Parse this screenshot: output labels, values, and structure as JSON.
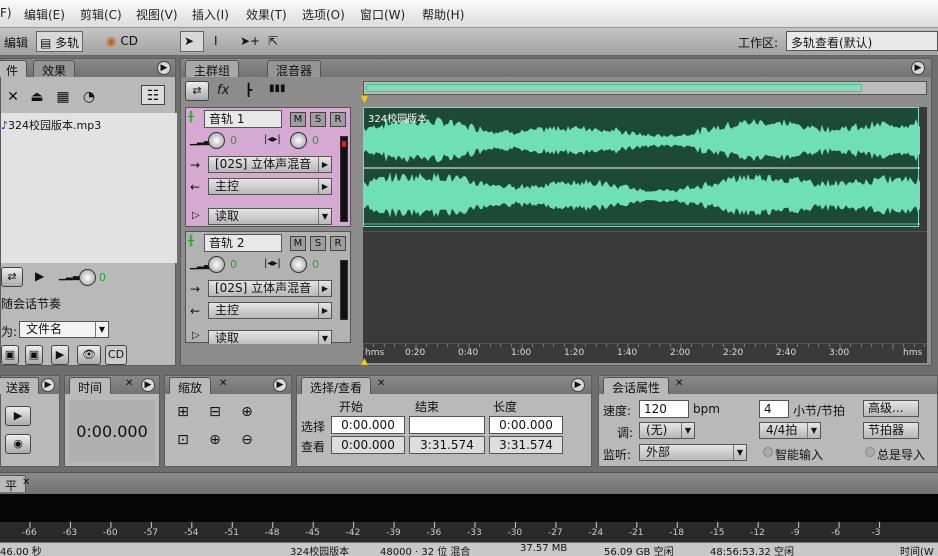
{
  "menu": [
    "F)",
    "编辑(E)",
    "剪辑(C)",
    "视图(V)",
    "插入(I)",
    "效果(T)",
    "选项(O)",
    "窗口(W)",
    "帮助(H)"
  ],
  "toolbar": {
    "edit": "编辑",
    "multitrack": "多轨",
    "cd": "CD",
    "workspace_label": "工作区:",
    "workspace_value": "多轨查看(默认)"
  },
  "files_panel": {
    "tab_files": "件",
    "tab_effects": "效果",
    "file": "324校园版本.mp3",
    "session_tempo": "随会话节奏",
    "sort_label": "为:",
    "sort_value": "文件名"
  },
  "main_tabs": {
    "main": "主群组",
    "mixer": "混音器"
  },
  "tracks": [
    {
      "name": "音轨 1",
      "vol": "0",
      "pan": "0",
      "input": "[02S] 立体声混音",
      "output": "主控",
      "mode": "读取"
    },
    {
      "name": "音轨 2",
      "vol": "0",
      "pan": "0",
      "input": "[02S] 立体声混音",
      "output": "主控",
      "mode": "读取"
    }
  ],
  "clip_name": "324校园版本",
  "timeline_ticks": [
    "hms",
    "0:20",
    "0:40",
    "1:00",
    "1:20",
    "1:40",
    "2:00",
    "2:20",
    "2:40",
    "3:00",
    "hms"
  ],
  "transport_panel": {
    "title": "送器"
  },
  "time_panel": {
    "title": "时间",
    "value": "0:00.000"
  },
  "zoom_panel": {
    "title": "缩放"
  },
  "selection_panel": {
    "title": "选择/查看",
    "col_start": "开始",
    "col_end": "结束",
    "col_length": "长度",
    "row_select": "选择",
    "row_view": "查看",
    "sel_start": "0:00.000",
    "sel_end": "",
    "sel_length": "0:00.000",
    "view_start": "0:00.000",
    "view_end": "3:31.574",
    "view_length": "3:31.574"
  },
  "session_panel": {
    "title": "会话属性",
    "tempo_label": "速度:",
    "tempo_value": "120",
    "bpm": "bpm",
    "beats_value": "4",
    "beats_label": "小节/节拍",
    "advanced": "高级...",
    "key_label": "调:",
    "key_value": "(无)",
    "time_sig": "4/4拍",
    "metronome": "节拍器",
    "monitor_label": "监听:",
    "monitor_value": "外部",
    "smart_input": "智能输入",
    "always_import": "总是导入"
  },
  "level_panel": {
    "title": "平"
  },
  "meter_ticks": [
    "-66",
    "-63",
    "-60",
    "-57",
    "-54",
    "-51",
    "-48",
    "-45",
    "-42",
    "-39",
    "-36",
    "-33",
    "-30",
    "-27",
    "-24",
    "-21",
    "-18",
    "-15",
    "-12",
    "-9",
    "-6",
    "-3"
  ],
  "status_bar": [
    "46.00 秒",
    "324校园版本",
    "48000 · 32 位 混合",
    "37.57 MB",
    "56.09 GB 空闲",
    "48:56:53.32 空闲",
    "时间(W"
  ],
  "colors": {
    "waveform": "#6fe0b5",
    "wave_bg": "#1c4a36",
    "track_selected": "#d6a9d2"
  }
}
